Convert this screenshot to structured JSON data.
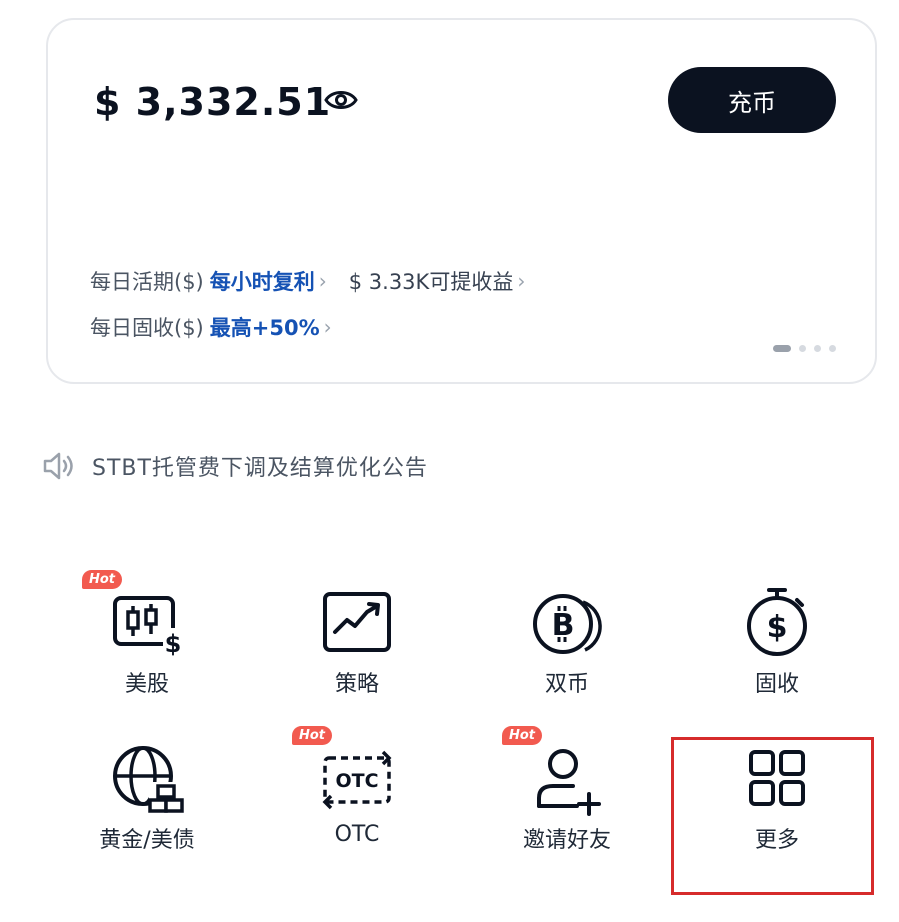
{
  "card": {
    "balance": "$ 3,332.51",
    "deposit_label": "充币",
    "row1": {
      "label": "每日活期($)",
      "accent": "每小时复利",
      "extra": "$ 3.33K可提收益"
    },
    "row2": {
      "label": "每日固收($)",
      "accent": "最高+50%"
    },
    "carousel_pages": 4,
    "carousel_active": 1
  },
  "notice": {
    "text": "STBT托管费下调及结算优化公告"
  },
  "hot_badge": "Hot",
  "menu": [
    {
      "label": "美股",
      "icon": "us-stock-candlestick-icon",
      "hot": true
    },
    {
      "label": "策略",
      "icon": "strategy-chart-icon",
      "hot": false
    },
    {
      "label": "双币",
      "icon": "dual-currency-bitcoin-icon",
      "hot": false
    },
    {
      "label": "固收",
      "icon": "fixed-income-stopwatch-icon",
      "hot": false
    },
    {
      "label": "黄金/美债",
      "icon": "gold-globe-icon",
      "hot": false
    },
    {
      "label": "OTC",
      "icon": "otc-exchange-icon",
      "hot": true
    },
    {
      "label": "邀请好友",
      "icon": "invite-user-icon",
      "hot": true
    },
    {
      "label": "更多",
      "icon": "grid-more-icon",
      "hot": false
    }
  ],
  "colors": {
    "primary": "#0b1220",
    "accent_blue": "#1552b4",
    "hot_red": "#f25a4f",
    "highlight_red": "#d62b2b"
  }
}
